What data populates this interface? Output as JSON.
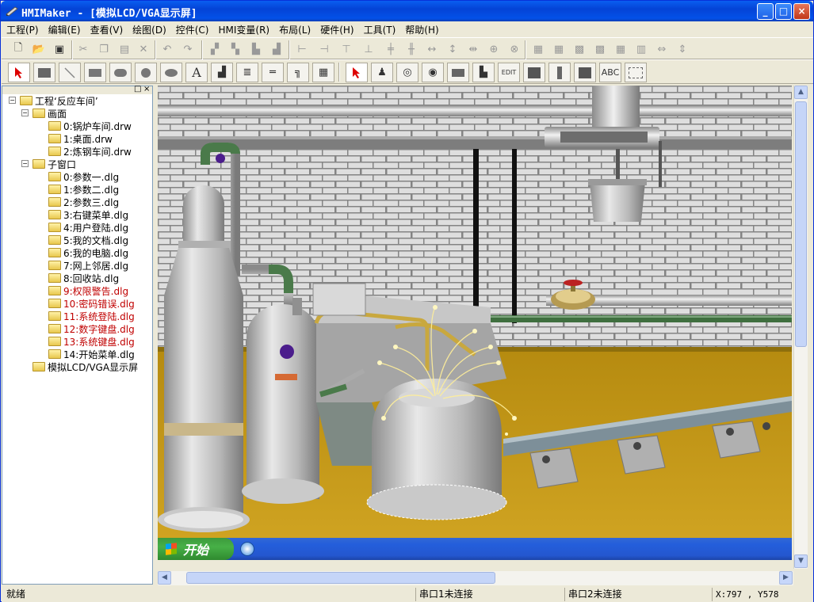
{
  "window": {
    "title": "HMIMaker - [模拟LCD/VGA显示屏]",
    "minimize": "_",
    "maximize": "□",
    "close": "×"
  },
  "menu": [
    "工程(P)",
    "编辑(E)",
    "查看(V)",
    "绘图(D)",
    "控件(C)",
    "HMI变量(R)",
    "布局(L)",
    "硬件(H)",
    "工具(T)",
    "帮助(H)"
  ],
  "toolbar2": {
    "abc_label": "ABC",
    "edit_label": "EDIT"
  },
  "tree": {
    "header_buttons": [
      "□",
      "×"
    ],
    "project": "工程‘反应车间’",
    "screens_label": "画面",
    "screens": [
      "0:锅炉车间.drw",
      "1:桌面.drw",
      "2:炼钢车间.drw"
    ],
    "dialogs_label": "子窗口",
    "dialogs": [
      "0:参数一.dlg",
      "1:参数二.dlg",
      "2:参数三.dlg",
      "3:右键菜单.dlg",
      "4:用户登陆.dlg",
      "5:我的文档.dlg",
      "6:我的电脑.dlg",
      "7:网上邻居.dlg",
      "8:回收站.dlg",
      "9:权限警告.dlg",
      "10:密码错误.dlg",
      "11:系统登陆.dlg",
      "12:数字键盘.dlg",
      "13:系统键盘.dlg",
      "14:开始菜单.dlg"
    ],
    "red_dialogs": [
      9,
      10,
      11,
      12,
      13
    ],
    "display": "模拟LCD/VGA显示屏"
  },
  "startbar": {
    "start_label": "开始"
  },
  "status": {
    "ready": "就绪",
    "port1": "串口1未连接",
    "port2": "串口2未连接",
    "coords": "X:797 , Y578"
  },
  "colors": {
    "title_blue": "#0a5ef0",
    "floor": "#c39a1a",
    "brick": "#e3e3e3",
    "red_item": "#c00000"
  }
}
